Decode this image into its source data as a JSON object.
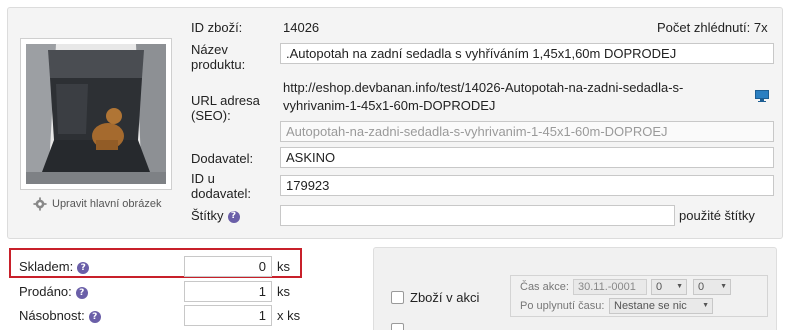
{
  "product": {
    "id_label": "ID zboží:",
    "id_value": "14026",
    "views_label": "Počet zhlédnutí: 7x",
    "name_label_1": "Název",
    "name_label_2": "produktu:",
    "name_value": ".Autopotah na zadní sedadla s vyhříváním 1,45x1,60m DOPRODEJ",
    "url_label_1": "URL adresa",
    "url_label_2": "(SEO):",
    "url_line_1": "http://eshop.devbanan.info/test/14026-Autopotah-na-zadni-sedadla-s-",
    "url_line_2": "vyhrivanim-1-45x1-60m-DOPRODEJ",
    "seo_placeholder": "Autopotah-na-zadni-sedadla-s-vyhrivanim-1-45x1-60m-DOPROEJ",
    "supplier_label": "Dodavatel:",
    "supplier_value": "ASKINO",
    "supplier_id_label_1": "ID u",
    "supplier_id_label_2": "dodavatel:",
    "supplier_id_value": "179923",
    "tags_label": "Štítky",
    "tags_value": "",
    "used_tags_label": "použité štítky",
    "edit_image_label": "Upravit hlavní obrázek"
  },
  "stock": {
    "stock_label": "Skladem:",
    "stock_value": "0",
    "stock_unit": "ks",
    "sold_label": "Prodáno:",
    "sold_value": "1",
    "sold_unit": "ks",
    "multiple_label": "Násobnost:",
    "multiple_value": "1",
    "multiple_unit": "x ks"
  },
  "action": {
    "checkbox_label": "Zboží v akci",
    "time_label": "Čas akce:",
    "date_value": "30.11.-0001",
    "hour_value": "0",
    "minute_value": "0",
    "after_label": "Po uplynutí času:",
    "after_value": "Nestane se nic"
  },
  "help_glyph": "?",
  "colors": {
    "highlight_border": "#c8202a",
    "help_icon": "#6a5fa8"
  }
}
